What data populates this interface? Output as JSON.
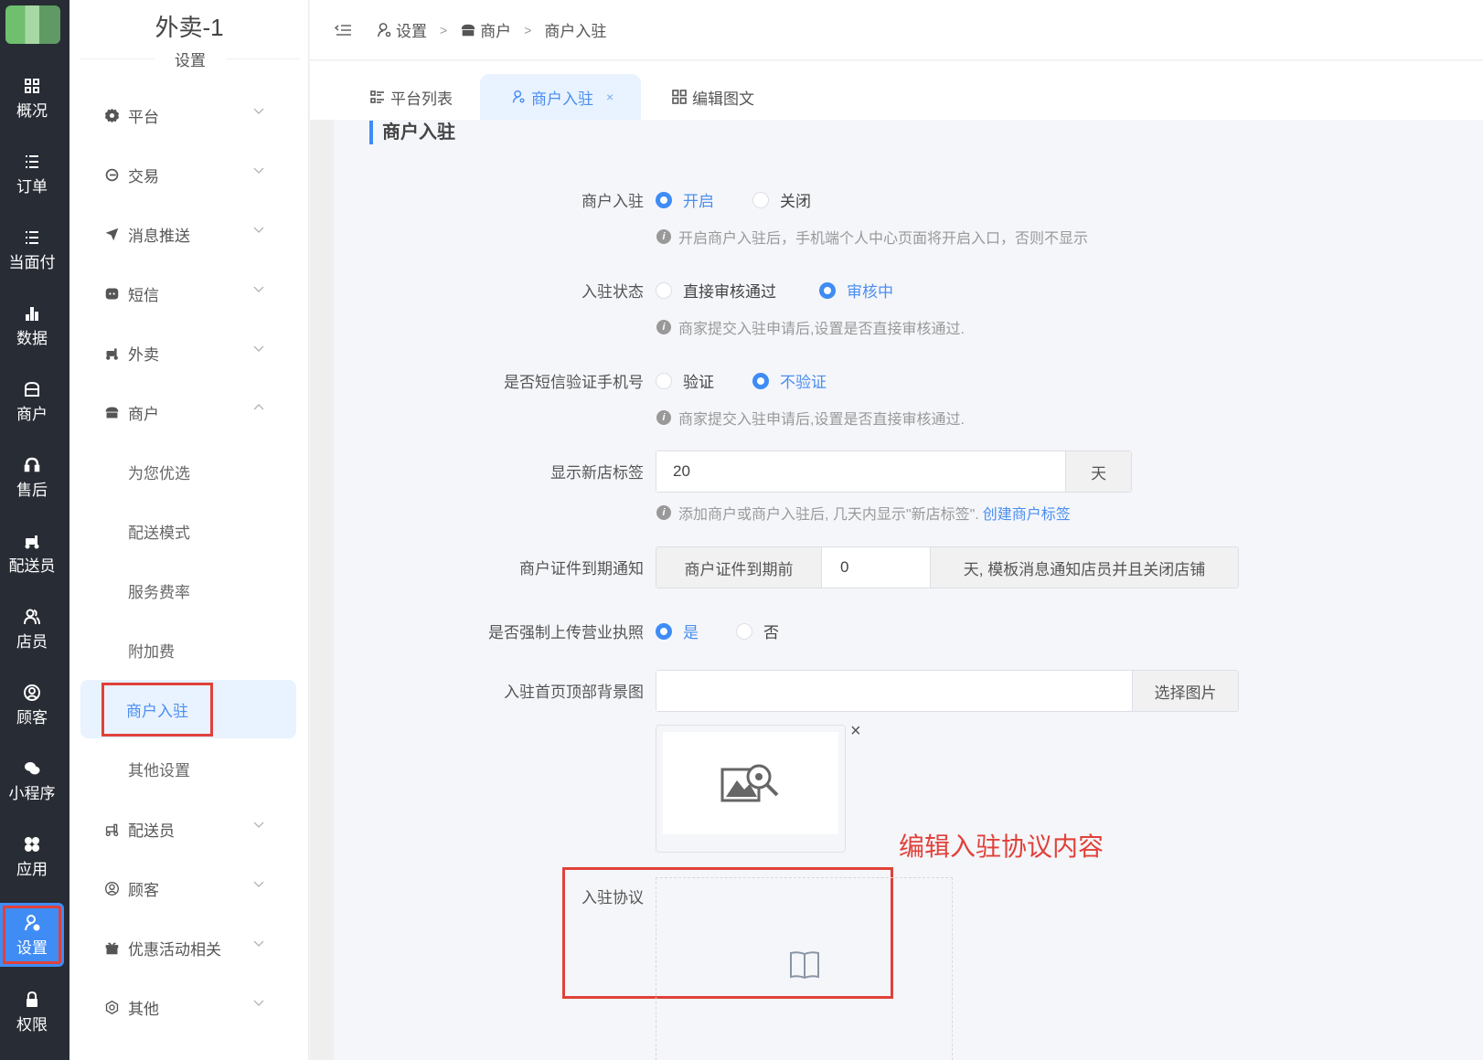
{
  "rail": {
    "logo": "app-logo",
    "items": [
      {
        "label": "概况",
        "icon": "grid-icon"
      },
      {
        "label": "订单",
        "icon": "list-icon"
      },
      {
        "label": "当面付",
        "icon": "list-icon"
      },
      {
        "label": "数据",
        "icon": "bar-chart-icon"
      },
      {
        "label": "商户",
        "icon": "store-icon"
      },
      {
        "label": "售后",
        "icon": "headset-icon"
      },
      {
        "label": "配送员",
        "icon": "scooter-icon"
      },
      {
        "label": "店员",
        "icon": "users-icon"
      },
      {
        "label": "顾客",
        "icon": "user-circle-icon"
      },
      {
        "label": "小程序",
        "icon": "wechat-icon"
      },
      {
        "label": "应用",
        "icon": "apps-icon"
      },
      {
        "label": "设置",
        "icon": "user-gear-icon",
        "active": true
      },
      {
        "label": "权限",
        "icon": "lock-icon"
      }
    ]
  },
  "sidebar": {
    "title": "外卖-1",
    "subtitle": "设置",
    "menu": [
      {
        "label": "平台",
        "icon": "gear-icon",
        "expanded": false
      },
      {
        "label": "交易",
        "icon": "coin-icon",
        "expanded": false
      },
      {
        "label": "消息推送",
        "icon": "send-icon",
        "expanded": false
      },
      {
        "label": "短信",
        "icon": "message-icon",
        "expanded": false
      },
      {
        "label": "外卖",
        "icon": "scooter-icon",
        "expanded": false
      },
      {
        "label": "商户",
        "icon": "store-icon",
        "expanded": true
      },
      {
        "label": "配送员",
        "icon": "scooter-icon",
        "expanded": false
      },
      {
        "label": "顾客",
        "icon": "user-circle-icon",
        "expanded": false
      },
      {
        "label": "优惠活动相关",
        "icon": "gift-icon",
        "expanded": false
      },
      {
        "label": "其他",
        "icon": "hexagon-icon",
        "expanded": false
      }
    ],
    "merchant_sub": [
      {
        "label": "为您优选"
      },
      {
        "label": "配送模式"
      },
      {
        "label": "服务费率"
      },
      {
        "label": "附加费"
      },
      {
        "label": "商户入驻",
        "active": true
      },
      {
        "label": "其他设置"
      }
    ]
  },
  "breadcrumb": {
    "items": [
      "设置",
      "商户",
      "商户入驻"
    ],
    "separator": ">"
  },
  "tabs": [
    {
      "label": "平台列表",
      "icon": "list-icon"
    },
    {
      "label": "商户入驻",
      "icon": "user-gear-icon",
      "active": true,
      "closable": "×"
    },
    {
      "label": "编辑图文",
      "icon": "grid-icon"
    }
  ],
  "page": {
    "section_title": "商户入驻",
    "fields": {
      "enable": {
        "label": "商户入驻",
        "options": [
          "开启",
          "关闭"
        ],
        "selected": "开启",
        "help": "开启商户入驻后，手机端个人中心页面将开启入口，否则不显示"
      },
      "status": {
        "label": "入驻状态",
        "options": [
          "直接审核通过",
          "审核中"
        ],
        "selected": "审核中",
        "help": "商家提交入驻申请后,设置是否直接审核通过."
      },
      "sms_verify": {
        "label": "是否短信验证手机号",
        "options": [
          "验证",
          "不验证"
        ],
        "selected": "不验证",
        "help": "商家提交入驻申请后,设置是否直接审核通过."
      },
      "new_tag": {
        "label": "显示新店标签",
        "value": "20",
        "suffix": "天",
        "help": "添加商户或商户入驻后, 几天内显示\"新店标签\".",
        "link": "创建商户标签"
      },
      "cert_expiry": {
        "label": "商户证件到期通知",
        "prefix": "商户证件到期前",
        "value": "0",
        "suffix": "天, 模板消息通知店员并且关闭店铺"
      },
      "force_license": {
        "label": "是否强制上传营业执照",
        "options": [
          "是",
          "否"
        ],
        "selected": "是"
      },
      "bg_image": {
        "label": "入驻首页顶部背景图",
        "value": "",
        "button": "选择图片",
        "remove": "×"
      },
      "agreement": {
        "label": "入驻协议"
      }
    },
    "annotation": "编辑入驻协议内容"
  },
  "colors": {
    "primary": "#3f8cf5",
    "rail_bg": "#282c35",
    "annotation_red": "#e0413a",
    "active_bg": "#e9f3ff"
  }
}
